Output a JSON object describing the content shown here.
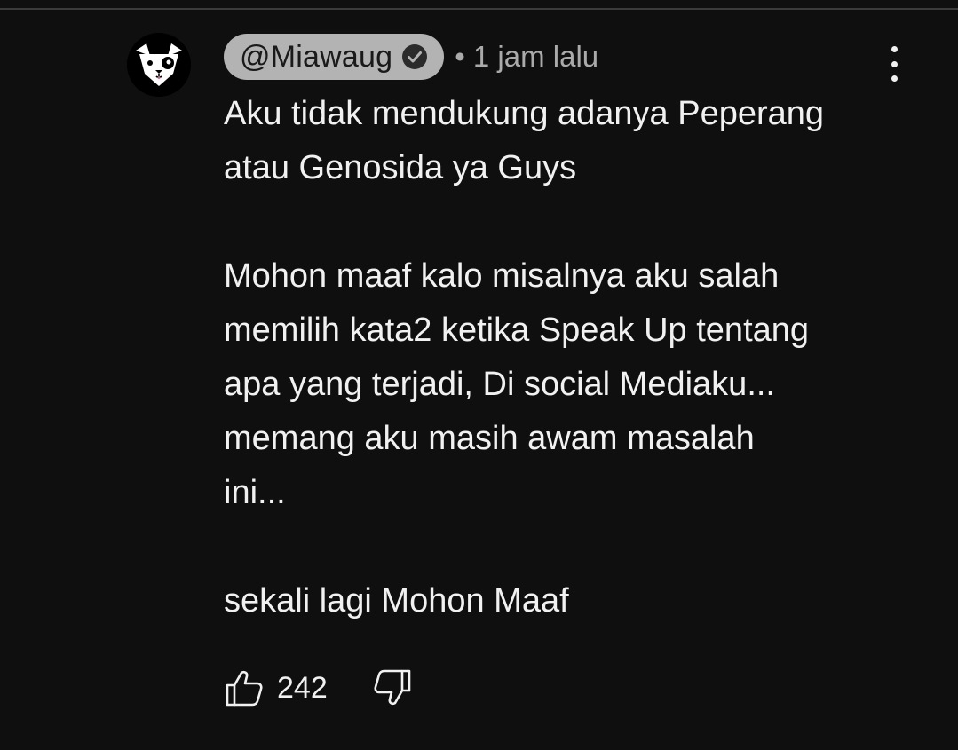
{
  "comment": {
    "channel_name": "@Miawaug",
    "verified": true,
    "timestamp": "• 1 jam lalu",
    "paragraphs": [
      "Aku tidak mendukung adanya Peperang\natau Genosida ya Guys",
      "Mohon maaf kalo misalnya aku salah\nmemilih kata2 ketika Speak Up tentang\napa yang terjadi, Di social Mediaku...\nmemang aku masih awam masalah\nini...",
      "sekali lagi Mohon Maaf"
    ],
    "like_count": "242"
  },
  "icons": {
    "avatar": "dog-face-avatar",
    "verified": "check-circle-icon",
    "menu": "more-vertical-icon",
    "like": "thumbs-up-icon",
    "dislike": "thumbs-down-icon"
  },
  "colors": {
    "background": "#0f0f0f",
    "text": "#f1f1f1",
    "secondary_text": "#aaaaaa",
    "channel_pill": "#b3b3b3"
  }
}
